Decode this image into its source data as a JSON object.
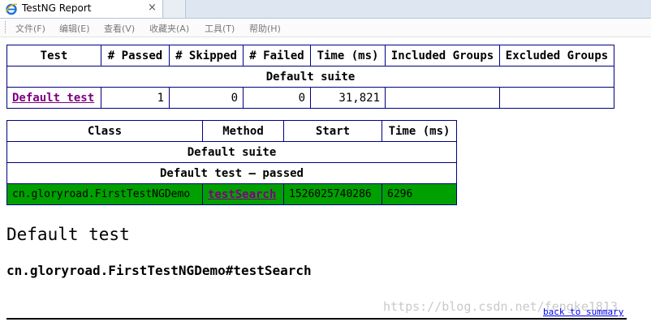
{
  "browser": {
    "tab_title": "TestNG Report",
    "close_glyph": "×",
    "icon": "ie-icon",
    "menu": [
      "文件(F)",
      "编辑(E)",
      "查看(V)",
      "收藏夹(A)",
      "工具(T)",
      "帮助(H)"
    ]
  },
  "suite_table": {
    "headers": [
      "Test",
      "# Passed",
      "# Skipped",
      "# Failed",
      "Time (ms)",
      "Included Groups",
      "Excluded Groups"
    ],
    "suite_name": "Default suite",
    "row": {
      "test": "Default test",
      "passed": "1",
      "skipped": "0",
      "failed": "0",
      "time": "31,821",
      "included": "",
      "excluded": ""
    }
  },
  "method_table": {
    "headers": [
      "Class",
      "Method",
      "Start",
      "Time (ms)"
    ],
    "suite_name": "Default suite",
    "test_status": "Default test — passed",
    "row": {
      "class": "cn.gloryroad.FirstTestNGDemo",
      "method": "testSearch",
      "start": "1526025740286",
      "time": "6296"
    },
    "row_color": "#00a000"
  },
  "detail": {
    "heading": "Default test",
    "method_full": "cn.gloryroad.FirstTestNGDemo#testSearch",
    "back_link": "back to summary"
  },
  "watermark": "https://blog.csdn.net/fengke1813"
}
